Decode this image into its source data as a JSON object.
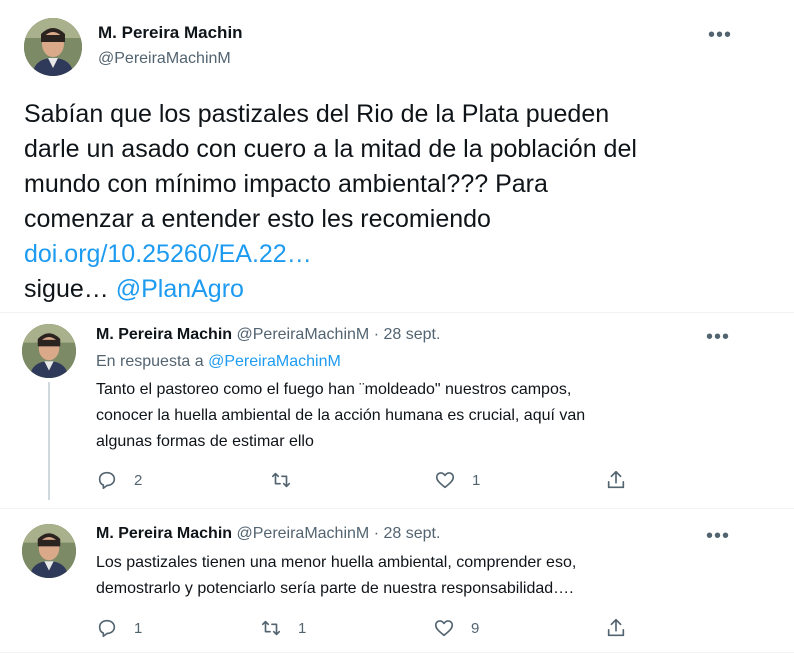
{
  "main_tweet": {
    "author_name": "M. Pereira Machin",
    "author_handle": "@PereiraMachinM",
    "text_lines": [
      "Sabían que los pastizales del Rio de la Plata pueden",
      "darle un asado con cuero a la mitad de la población del",
      "mundo con mínimo impacto ambiental??? Para",
      "comenzar a entender esto les recomiendo"
    ],
    "link": "doi.org/10.25260/EA.22…",
    "continue_text": "sigue… ",
    "mention": "@PlanAgro"
  },
  "replies": [
    {
      "author_name": "M. Pereira Machin",
      "author_handle": "@PereiraMachinM",
      "date": "· 28 sept.",
      "reply_to_label": "En respuesta a ",
      "reply_to_handle": "@PereiraMachinM",
      "text_lines": [
        "Tanto el pastoreo como el fuego han ¨moldeado\" nuestros campos,",
        "conocer la huella ambiental de la acción humana es crucial, aquí van",
        "algunas formas de estimar ello"
      ],
      "reply_count": "2",
      "retweet_count": "",
      "like_count": "1"
    },
    {
      "author_name": "M. Pereira Machin",
      "author_handle": "@PereiraMachinM",
      "date": "· 28 sept.",
      "text_lines": [
        "Los pastizales tienen una menor huella ambiental, comprender eso,",
        "demostrarlo y potenciarlo sería parte de nuestra responsabilidad…."
      ],
      "reply_count": "1",
      "retweet_count": "1",
      "like_count": "9"
    }
  ],
  "more_label": "•••",
  "colors": {
    "link": "#1d9bf0",
    "secondary": "#536471",
    "text": "#0f1419"
  }
}
